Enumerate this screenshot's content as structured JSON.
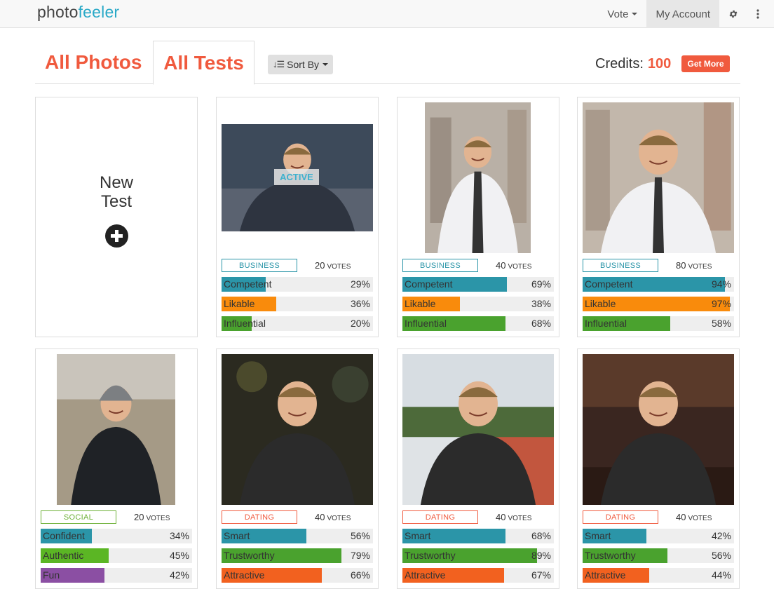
{
  "nav": {
    "logo_a": "photo",
    "logo_b": "feeler",
    "vote": "Vote",
    "account": "My Account",
    "gear_icon": "gear-icon",
    "dots_icon": "vertical-dots-icon"
  },
  "tabs": {
    "photos": "All Photos",
    "tests": "All Tests",
    "sort": "Sort By",
    "credits_label": "Credits:",
    "credits_value": "100",
    "get_more": "Get More"
  },
  "colors": {
    "accent": "#f05a3e",
    "business": "#2b95a8",
    "dating": "#f05a3e",
    "social": "#6cb036",
    "competent": "#2b95a8",
    "likable": "#f98b0c",
    "influential": "#4aa22e",
    "confident": "#2b95a8",
    "authentic": "#5bb624",
    "fun": "#8b4fa3",
    "smart": "#2b95a8",
    "trustworthy": "#4aa22e",
    "attractive": "#f2611f"
  },
  "new_test": {
    "line1": "New",
    "line2": "Test"
  },
  "cards": [
    {
      "category": "BUSINESS",
      "votes": "20",
      "votes_word": "votes",
      "active": "ACTIVE",
      "bars": [
        {
          "label": "Competent",
          "value": 29,
          "pct": "29%"
        },
        {
          "label": "Likable",
          "value": 36,
          "pct": "36%"
        },
        {
          "label": "Influential",
          "value": 20,
          "pct": "20%"
        }
      ]
    },
    {
      "category": "BUSINESS",
      "votes": "40",
      "votes_word": "votes",
      "bars": [
        {
          "label": "Competent",
          "value": 69,
          "pct": "69%"
        },
        {
          "label": "Likable",
          "value": 38,
          "pct": "38%"
        },
        {
          "label": "Influential",
          "value": 68,
          "pct": "68%"
        }
      ]
    },
    {
      "category": "BUSINESS",
      "votes": "80",
      "votes_word": "votes",
      "bars": [
        {
          "label": "Competent",
          "value": 94,
          "pct": "94%"
        },
        {
          "label": "Likable",
          "value": 97,
          "pct": "97%"
        },
        {
          "label": "Influential",
          "value": 58,
          "pct": "58%"
        }
      ]
    },
    {
      "category": "SOCIAL",
      "votes": "20",
      "votes_word": "votes",
      "bars": [
        {
          "label": "Confident",
          "value": 34,
          "pct": "34%"
        },
        {
          "label": "Authentic",
          "value": 45,
          "pct": "45%"
        },
        {
          "label": "Fun",
          "value": 42,
          "pct": "42%"
        }
      ]
    },
    {
      "category": "DATING",
      "votes": "40",
      "votes_word": "votes",
      "bars": [
        {
          "label": "Smart",
          "value": 56,
          "pct": "56%"
        },
        {
          "label": "Trustworthy",
          "value": 79,
          "pct": "79%"
        },
        {
          "label": "Attractive",
          "value": 66,
          "pct": "66%"
        }
      ]
    },
    {
      "category": "DATING",
      "votes": "40",
      "votes_word": "votes",
      "bars": [
        {
          "label": "Smart",
          "value": 68,
          "pct": "68%"
        },
        {
          "label": "Trustworthy",
          "value": 89,
          "pct": "89%"
        },
        {
          "label": "Attractive",
          "value": 67,
          "pct": "67%"
        }
      ]
    },
    {
      "category": "DATING",
      "votes": "40",
      "votes_word": "votes",
      "bars": [
        {
          "label": "Smart",
          "value": 42,
          "pct": "42%"
        },
        {
          "label": "Trustworthy",
          "value": 56,
          "pct": "56%"
        },
        {
          "label": "Attractive",
          "value": 44,
          "pct": "44%"
        }
      ]
    }
  ]
}
